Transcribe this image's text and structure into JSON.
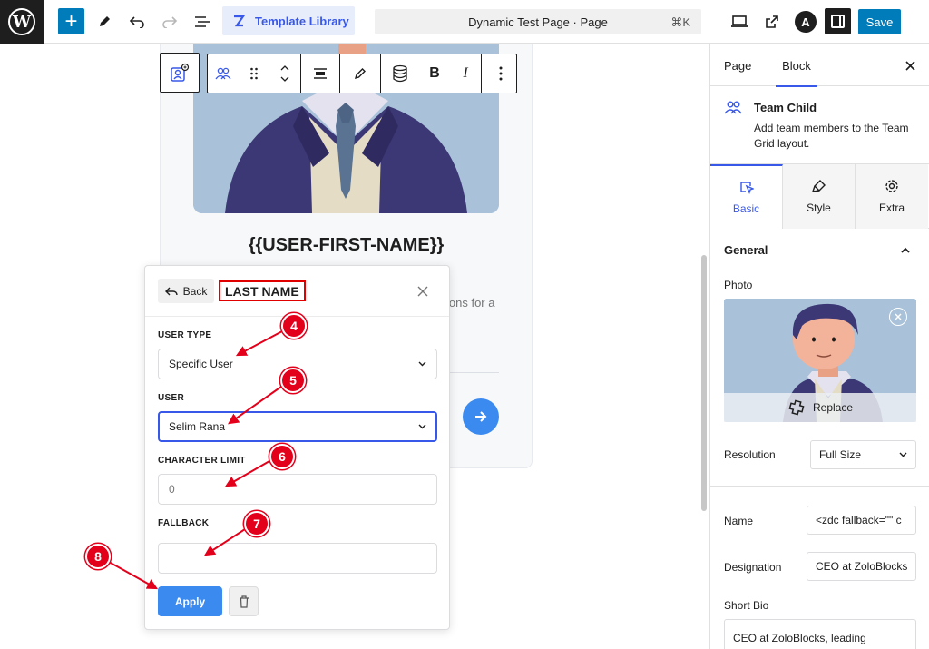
{
  "topbar": {
    "wp_logo": "W",
    "add_label": "+",
    "template_library": "Template Library",
    "document_title": "Dynamic Test Page · Page",
    "shortcut": "⌘K",
    "astra_letter": "A",
    "save_label": "Save"
  },
  "canvas": {
    "team_card": {
      "name_placeholder": "{{USER-FIRST-NAME}}",
      "bio_excerpt": "ions for a"
    }
  },
  "popover": {
    "back_label": "Back",
    "title": "LAST NAME",
    "fields": {
      "user_type_label": "USER TYPE",
      "user_type_value": "Specific User",
      "user_label": "USER",
      "user_value": "Selim Rana",
      "character_limit_label": "CHARACTER LIMIT",
      "character_limit_placeholder": "0",
      "fallback_label": "FALLBACK",
      "fallback_value": ""
    },
    "apply_label": "Apply"
  },
  "annotations": {
    "marker_4": "4",
    "marker_5": "5",
    "marker_6": "6",
    "marker_7": "7",
    "marker_8": "8",
    "color": "#e3001b"
  },
  "sidebar": {
    "tabs": {
      "page": "Page",
      "block": "Block"
    },
    "block_card": {
      "title": "Team Child",
      "description": "Add team members to the Team Grid layout."
    },
    "sub_tabs": {
      "basic": "Basic",
      "style": "Style",
      "extra": "Extra"
    },
    "section_title": "General",
    "photo_label": "Photo",
    "replace_label": "Replace",
    "resolution_label": "Resolution",
    "resolution_value": "Full Size",
    "name_label": "Name",
    "name_value": "<zdc fallback=\"\" c",
    "designation_label": "Designation",
    "designation_value": "CEO at ZoloBlocks",
    "short_bio_label": "Short Bio",
    "short_bio_value": "CEO at ZoloBlocks, leading"
  },
  "colors": {
    "wp_blue": "#007cba",
    "accent": "#3858e9",
    "button_blue": "#3b8af0",
    "annotation_red": "#e3001b"
  }
}
